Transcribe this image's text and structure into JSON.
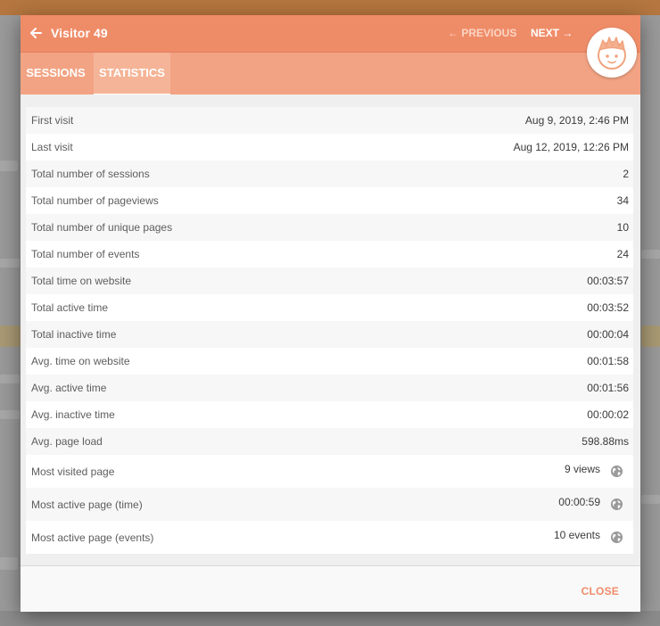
{
  "header": {
    "title": "Visitor 49",
    "prev_label": "← PREVIOUS",
    "next_label": "NEXT →"
  },
  "tabs": [
    {
      "label": "SESSIONS",
      "active": false
    },
    {
      "label": "STATISTICS",
      "active": true
    }
  ],
  "stats": [
    {
      "label": "First visit",
      "value": "Aug 9, 2019, 2:46 PM"
    },
    {
      "label": "Last visit",
      "value": "Aug 12, 2019, 12:26 PM"
    },
    {
      "label": "Total number of sessions",
      "value": "2"
    },
    {
      "label": "Total number of pageviews",
      "value": "34"
    },
    {
      "label": "Total number of unique pages",
      "value": "10"
    },
    {
      "label": "Total number of events",
      "value": "24"
    },
    {
      "label": "Total time on website",
      "value": "00:03:57"
    },
    {
      "label": "Total active time",
      "value": "00:03:52"
    },
    {
      "label": "Total inactive time",
      "value": "00:00:04"
    },
    {
      "label": "Avg. time on website",
      "value": "00:01:58"
    },
    {
      "label": "Avg. active time",
      "value": "00:01:56"
    },
    {
      "label": "Avg. inactive time",
      "value": "00:00:02"
    },
    {
      "label": "Avg. page load",
      "value": "598.88ms"
    }
  ],
  "top_pages": [
    {
      "label": "Most visited page",
      "value": "9 views",
      "icon": "globe-icon"
    },
    {
      "label": "Most active page (time)",
      "value": "00:00:59",
      "icon": "globe-icon"
    },
    {
      "label": "Most active page (events)",
      "value": "10 events",
      "icon": "globe-icon"
    }
  ],
  "footer": {
    "close_label": "CLOSE"
  },
  "colors": {
    "accent": "#ef8c68",
    "tabbar": "#f2a383"
  }
}
